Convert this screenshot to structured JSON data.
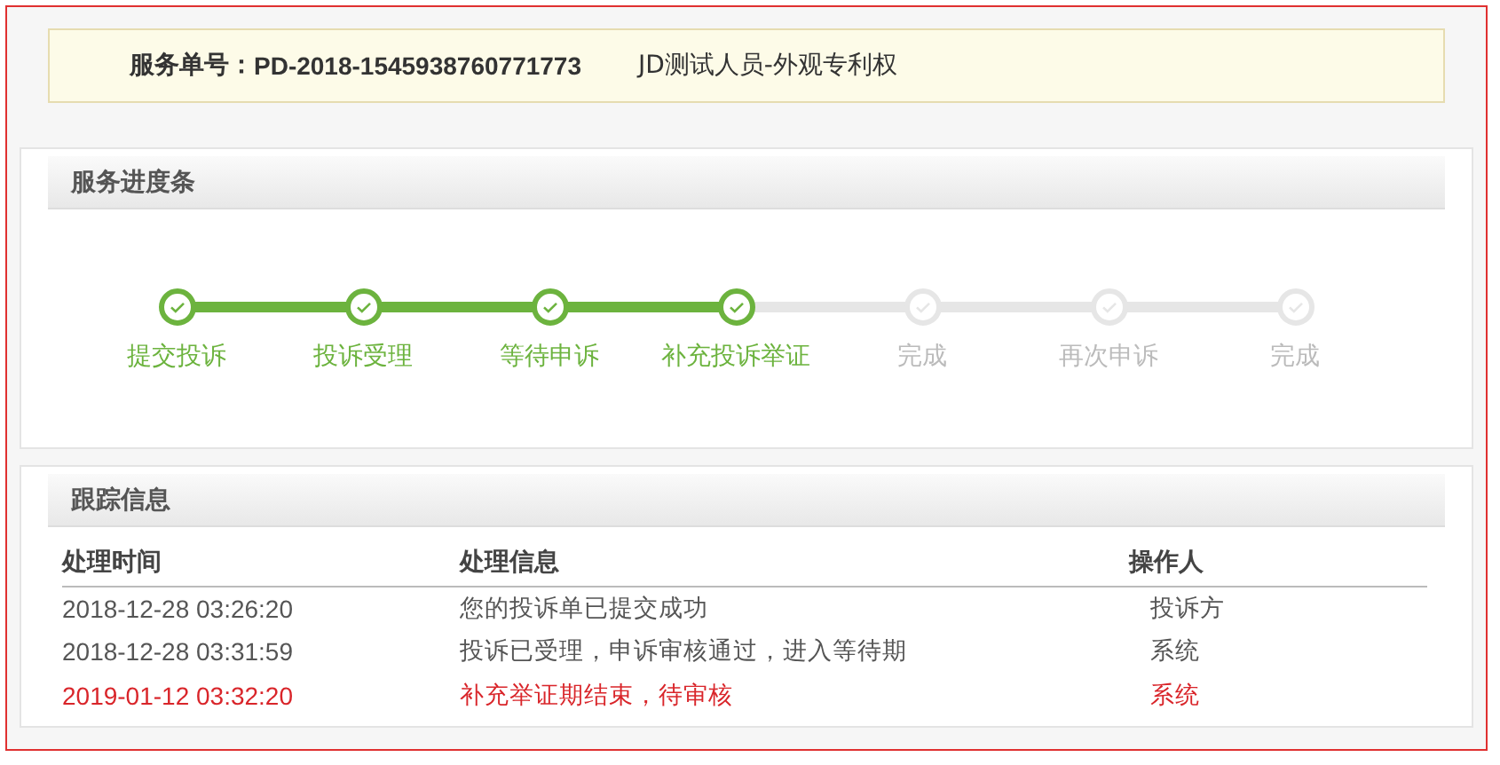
{
  "order": {
    "label": "服务单号：",
    "number": "PD-2018-1545938760771773",
    "title": "JD测试人员-外观专利权"
  },
  "progress": {
    "title": "服务进度条",
    "steps": [
      {
        "label": "提交投诉",
        "done": true
      },
      {
        "label": "投诉受理",
        "done": true
      },
      {
        "label": "等待申诉",
        "done": true
      },
      {
        "label": "补充投诉举证",
        "done": true
      },
      {
        "label": "完成",
        "done": false
      },
      {
        "label": "再次申诉",
        "done": false
      },
      {
        "label": "完成",
        "done": false
      }
    ]
  },
  "tracking": {
    "title": "跟踪信息",
    "columns": [
      "处理时间",
      "处理信息",
      "操作人"
    ],
    "rows": [
      {
        "time": "2018-12-28 03:26:20",
        "info": "您的投诉单已提交成功",
        "operator": "投诉方",
        "highlighted": false
      },
      {
        "time": "2018-12-28 03:31:59",
        "info": "投诉已受理，申诉审核通过，进入等待期",
        "operator": "系统",
        "highlighted": false
      },
      {
        "time": "2019-01-12 03:32:20",
        "info": "补充举证期结束，待审核",
        "operator": "系统",
        "highlighted": true
      }
    ]
  }
}
